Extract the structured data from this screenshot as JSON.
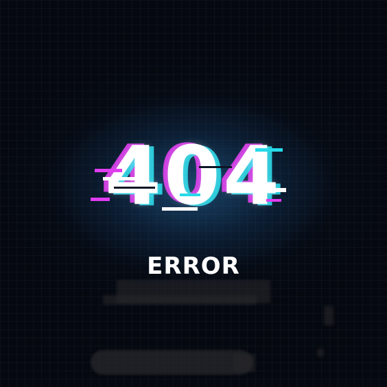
{
  "error_page": {
    "code": "404",
    "title": "ERROR"
  },
  "colors": {
    "background": "#05080f",
    "glow": "#143454",
    "text": "#ffffff",
    "glitch_magenta": "#e03cf0",
    "glitch_cyan": "#27d9e8"
  }
}
